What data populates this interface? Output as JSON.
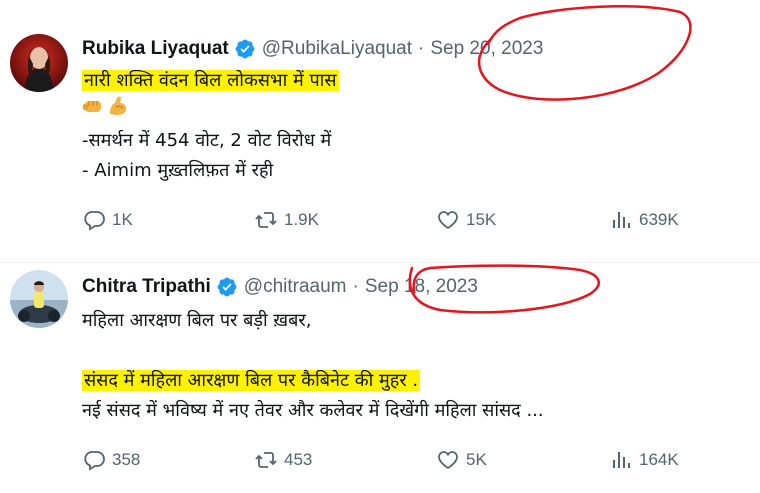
{
  "tweets": [
    {
      "name": "Rubika Liyaquat",
      "handle": "@RubikaLiyaquat",
      "separator": "·",
      "date": "Sep 20, 2023",
      "lines": [
        "नारी शक्ति वंदन बिल लोकसभा में पास",
        "",
        "-समर्थन में 454 वोट, 2 वोट विरोध में",
        "- Aimim मुख़्तलिफ़त में रही"
      ],
      "emojis": [
        "fist-icon",
        "flexed-biceps-icon"
      ],
      "stats": {
        "replies": "1K",
        "reposts": "1.9K",
        "likes": "15K",
        "views": "639K"
      }
    },
    {
      "name": "Chitra Tripathi",
      "handle": "@chitraaum",
      "separator": "·",
      "date": "Sep 18, 2023",
      "lines": [
        "महिला आरक्षण बिल पर बड़ी ख़बर,",
        "",
        "संसद में महिला आरक्षण बिल पर कैबिनेट की मुहर .",
        "नई संसद में भविष्य में नए तेवर और कलेवर में दिखेंगी महिला सांसद ..."
      ],
      "stats": {
        "replies": "358",
        "reposts": "453",
        "likes": "5K",
        "views": "164K"
      }
    }
  ],
  "colors": {
    "verified": "#1d9bf0",
    "highlight": "#fff200",
    "annotation": "#e8141c",
    "muted": "#536471"
  }
}
